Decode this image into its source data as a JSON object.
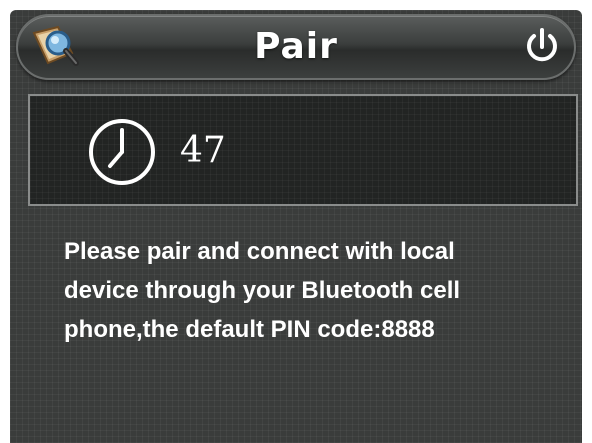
{
  "header": {
    "title": "Pair",
    "search_icon": "search-magnifier-icon",
    "power_icon": "power-icon"
  },
  "timer": {
    "icon": "clock-icon",
    "countdown": "47"
  },
  "message": {
    "text": "Please pair and connect with local\ndevice through your Bluetooth cell\nphone,the default PIN code:8888"
  },
  "colors": {
    "background": "#3a3c3b",
    "text": "#ffffff",
    "timer_border": "#8a8c8b"
  }
}
